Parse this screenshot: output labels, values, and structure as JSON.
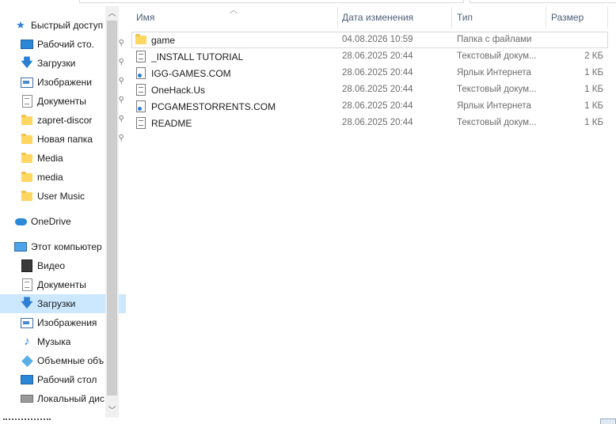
{
  "nav": {
    "items": [
      {
        "label": "Быстрый доступ",
        "icon": "star-icon",
        "level": 0,
        "pinned": false,
        "selected": false
      },
      {
        "label": "Рабочий сто.",
        "icon": "desktop-icon",
        "level": 1,
        "pinned": true,
        "selected": false
      },
      {
        "label": "Загрузки",
        "icon": "download-arrow-icon",
        "level": 1,
        "pinned": true,
        "selected": false
      },
      {
        "label": "Изображени",
        "icon": "pictures-icon",
        "level": 1,
        "pinned": true,
        "selected": false
      },
      {
        "label": "Документы",
        "icon": "documents-icon",
        "level": 1,
        "pinned": true,
        "selected": false
      },
      {
        "label": "zapret-discor",
        "icon": "folder-icon",
        "level": 1,
        "pinned": true,
        "selected": false
      },
      {
        "label": "Новая папка",
        "icon": "folder-icon",
        "level": 1,
        "pinned": true,
        "selected": false
      },
      {
        "label": "Media",
        "icon": "folder-icon",
        "level": 1,
        "pinned": false,
        "selected": false
      },
      {
        "label": "media",
        "icon": "folder-icon",
        "level": 1,
        "pinned": false,
        "selected": false
      },
      {
        "label": "User Music",
        "icon": "folder-icon",
        "level": 1,
        "pinned": false,
        "selected": false
      },
      {
        "label": "OneDrive",
        "icon": "cloud-icon",
        "level": 0,
        "pinned": false,
        "selected": false
      },
      {
        "label": "Этот компьютер",
        "icon": "computer-icon",
        "level": 0,
        "pinned": false,
        "selected": false
      },
      {
        "label": "Видео",
        "icon": "video-icon",
        "level": 1,
        "pinned": false,
        "selected": false
      },
      {
        "label": "Документы",
        "icon": "documents-icon",
        "level": 1,
        "pinned": false,
        "selected": false
      },
      {
        "label": "Загрузки",
        "icon": "download-arrow-icon",
        "level": 1,
        "pinned": false,
        "selected": true
      },
      {
        "label": "Изображения",
        "icon": "pictures-icon",
        "level": 1,
        "pinned": false,
        "selected": false
      },
      {
        "label": "Музыка",
        "icon": "music-note-icon",
        "level": 1,
        "pinned": false,
        "selected": false
      },
      {
        "label": "Объемные объ",
        "icon": "3d-objects-icon",
        "level": 1,
        "pinned": false,
        "selected": false
      },
      {
        "label": "Рабочий стол",
        "icon": "desktop-icon",
        "level": 1,
        "pinned": false,
        "selected": false
      },
      {
        "label": "Локальный дис",
        "icon": "local-disk-icon",
        "level": 1,
        "pinned": false,
        "selected": false
      }
    ],
    "pin_glyph": "📌"
  },
  "columns": {
    "name": "Имя",
    "date": "Дата изменения",
    "type": "Тип",
    "size": "Размер"
  },
  "files": [
    {
      "name": "game",
      "date": "04.08.2026 10:59",
      "type": "Папка с файлами",
      "size": "",
      "icon": "folder-icon"
    },
    {
      "name": "_INSTALL TUTORIAL",
      "date": "28.06.2025 20:44",
      "type": "Текстовый докум...",
      "size": "2 КБ",
      "icon": "text-document-icon"
    },
    {
      "name": "IGG-GAMES.COM",
      "date": "28.06.2025 20:44",
      "type": "Ярлык Интернета",
      "size": "1 КБ",
      "icon": "internet-shortcut-icon"
    },
    {
      "name": "OneHack.Us",
      "date": "28.06.2025 20:44",
      "type": "Текстовый докум...",
      "size": "1 КБ",
      "icon": "text-document-icon"
    },
    {
      "name": "PCGAMESTORRENTS.COM",
      "date": "28.06.2025 20:44",
      "type": "Ярлык Интернета",
      "size": "1 КБ",
      "icon": "internet-shortcut-icon"
    },
    {
      "name": "README",
      "date": "28.06.2025 20:44",
      "type": "Текстовый докум...",
      "size": "1 КБ",
      "icon": "text-document-icon"
    }
  ]
}
